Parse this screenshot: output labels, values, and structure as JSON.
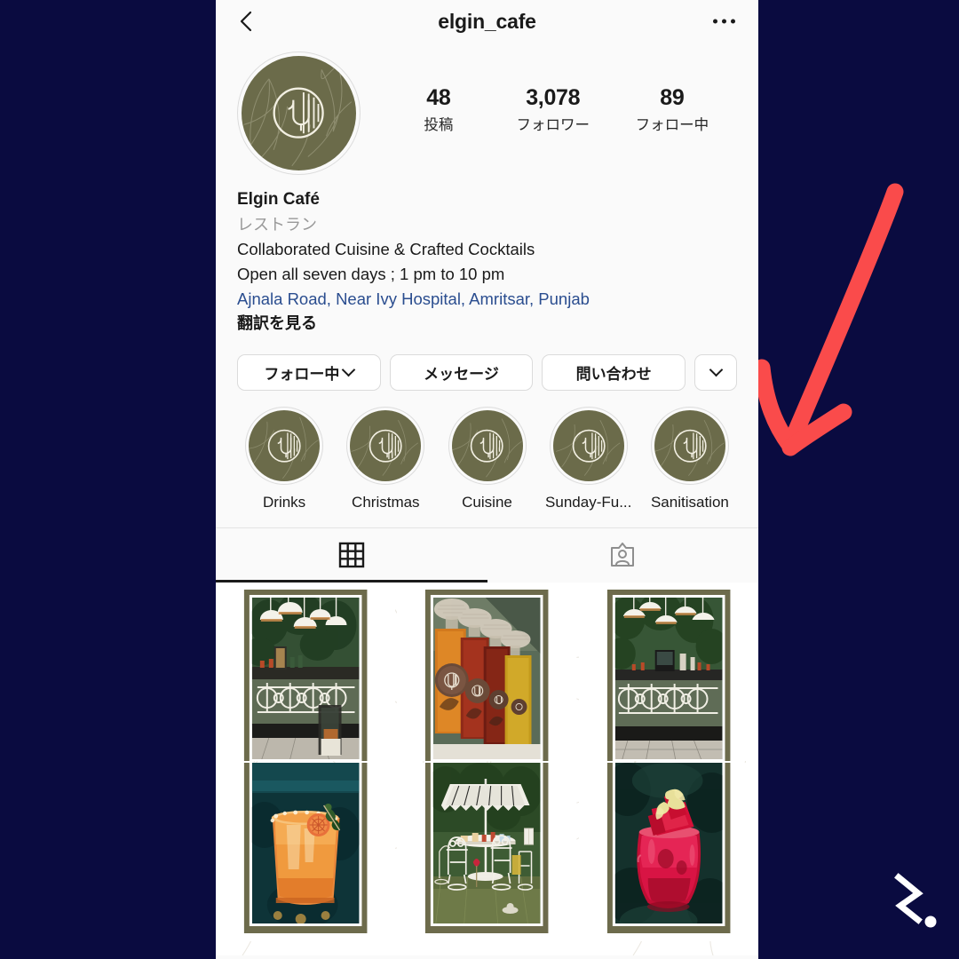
{
  "canvas": {
    "bg_color": "#0A0B40"
  },
  "topbar": {
    "title": "elgin_cafe",
    "back_icon": "chevron-left-icon",
    "more_icon": "more-options-icon"
  },
  "profile": {
    "avatar_icon": "profile-avatar",
    "brand_color": "#6B6B4A",
    "stats": [
      {
        "value": "48",
        "label": "投稿"
      },
      {
        "value": "3,078",
        "label": "フォロワー"
      },
      {
        "value": "89",
        "label": "フォロー中"
      }
    ],
    "display_name": "Elgin Café",
    "category": "レストラン",
    "bio_line_1": "Collaborated Cuisine & Crafted Cocktails",
    "bio_line_2": "Open all seven days ; 1 pm to 10 pm",
    "address": "Ajnala Road, Near Ivy Hospital, Amritsar, Punjab",
    "address_color": "#2A4D8F",
    "translate_label": "翻訳を見る"
  },
  "actions": [
    {
      "label": "フォロー中",
      "has_chevron": true,
      "name": "following-button"
    },
    {
      "label": "メッセージ",
      "has_chevron": false,
      "name": "message-button"
    },
    {
      "label": "問い合わせ",
      "has_chevron": false,
      "name": "contact-button"
    },
    {
      "label": "",
      "has_chevron": true,
      "name": "more-actions-button"
    }
  ],
  "highlights": [
    {
      "label": "Drinks"
    },
    {
      "label": "Christmas"
    },
    {
      "label": "Cuisine"
    },
    {
      "label": "Sunday-Fu..."
    },
    {
      "label": "Sanitisation"
    }
  ],
  "tabs": [
    {
      "icon": "grid-icon",
      "active": true,
      "name": "tab-posts-grid"
    },
    {
      "icon": "tagged-person-icon",
      "active": false,
      "name": "tab-tagged"
    }
  ],
  "posts": [
    {
      "caption": "outdoor-bar-with-dome-pendant-lights"
    },
    {
      "caption": "glass-decanters-with-brown-elgin-labels"
    },
    {
      "caption": "outdoor-bar-counter-with-greenery"
    },
    {
      "caption": "orange-cocktail-with-dried-citrus-garnish"
    },
    {
      "caption": "garden-seating-white-furniture-under-umbrella"
    },
    {
      "caption": "red-watermelon-cocktail-with-celery-garnish"
    }
  ],
  "annotations": {
    "arrow_color": "#FA4B4B",
    "arrow_icon": "red-arrow-pointing-down-left",
    "watermark_icon": "bracket-dot-logo",
    "watermark_color": "#FFFFFF"
  }
}
